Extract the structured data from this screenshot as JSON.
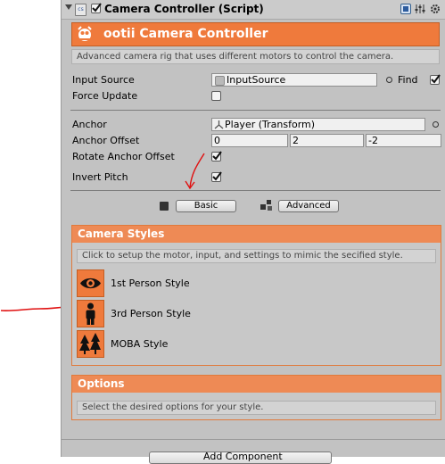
{
  "header": {
    "script_icon_text": "cs",
    "title": "Camera Controller (Script)",
    "enabled": true
  },
  "banner": {
    "title": "ootii Camera Controller"
  },
  "description": "Advanced camera rig that uses different motors to control the camera.",
  "fields": {
    "input_source_label": "Input Source",
    "input_source_value": "InputSource",
    "find_label": "Find",
    "force_update_label": "Force Update",
    "anchor_label": "Anchor",
    "anchor_value": "Player (Transform)",
    "anchor_offset_label": "Anchor Offset",
    "anchor_offset": {
      "x": "0",
      "y": "2",
      "z": "-2"
    },
    "rotate_anchor_offset_label": "Rotate Anchor Offset",
    "invert_pitch_label": "Invert Pitch"
  },
  "mode_buttons": {
    "basic": "Basic",
    "advanced": "Advanced"
  },
  "camera_styles": {
    "title": "Camera Styles",
    "description": "Click to setup the motor, input, and settings to mimic the secified style.",
    "items": [
      {
        "label": "1st Person Style",
        "icon": "eye-icon"
      },
      {
        "label": "3rd Person Style",
        "icon": "person-icon"
      },
      {
        "label": "MOBA Style",
        "icon": "trees-icon"
      }
    ]
  },
  "options": {
    "title": "Options",
    "description": "Select the desired options for your style."
  },
  "add_component_label": "Add Component",
  "colors": {
    "accent": "#ef7a3c",
    "annotation_red": "#e01010"
  }
}
